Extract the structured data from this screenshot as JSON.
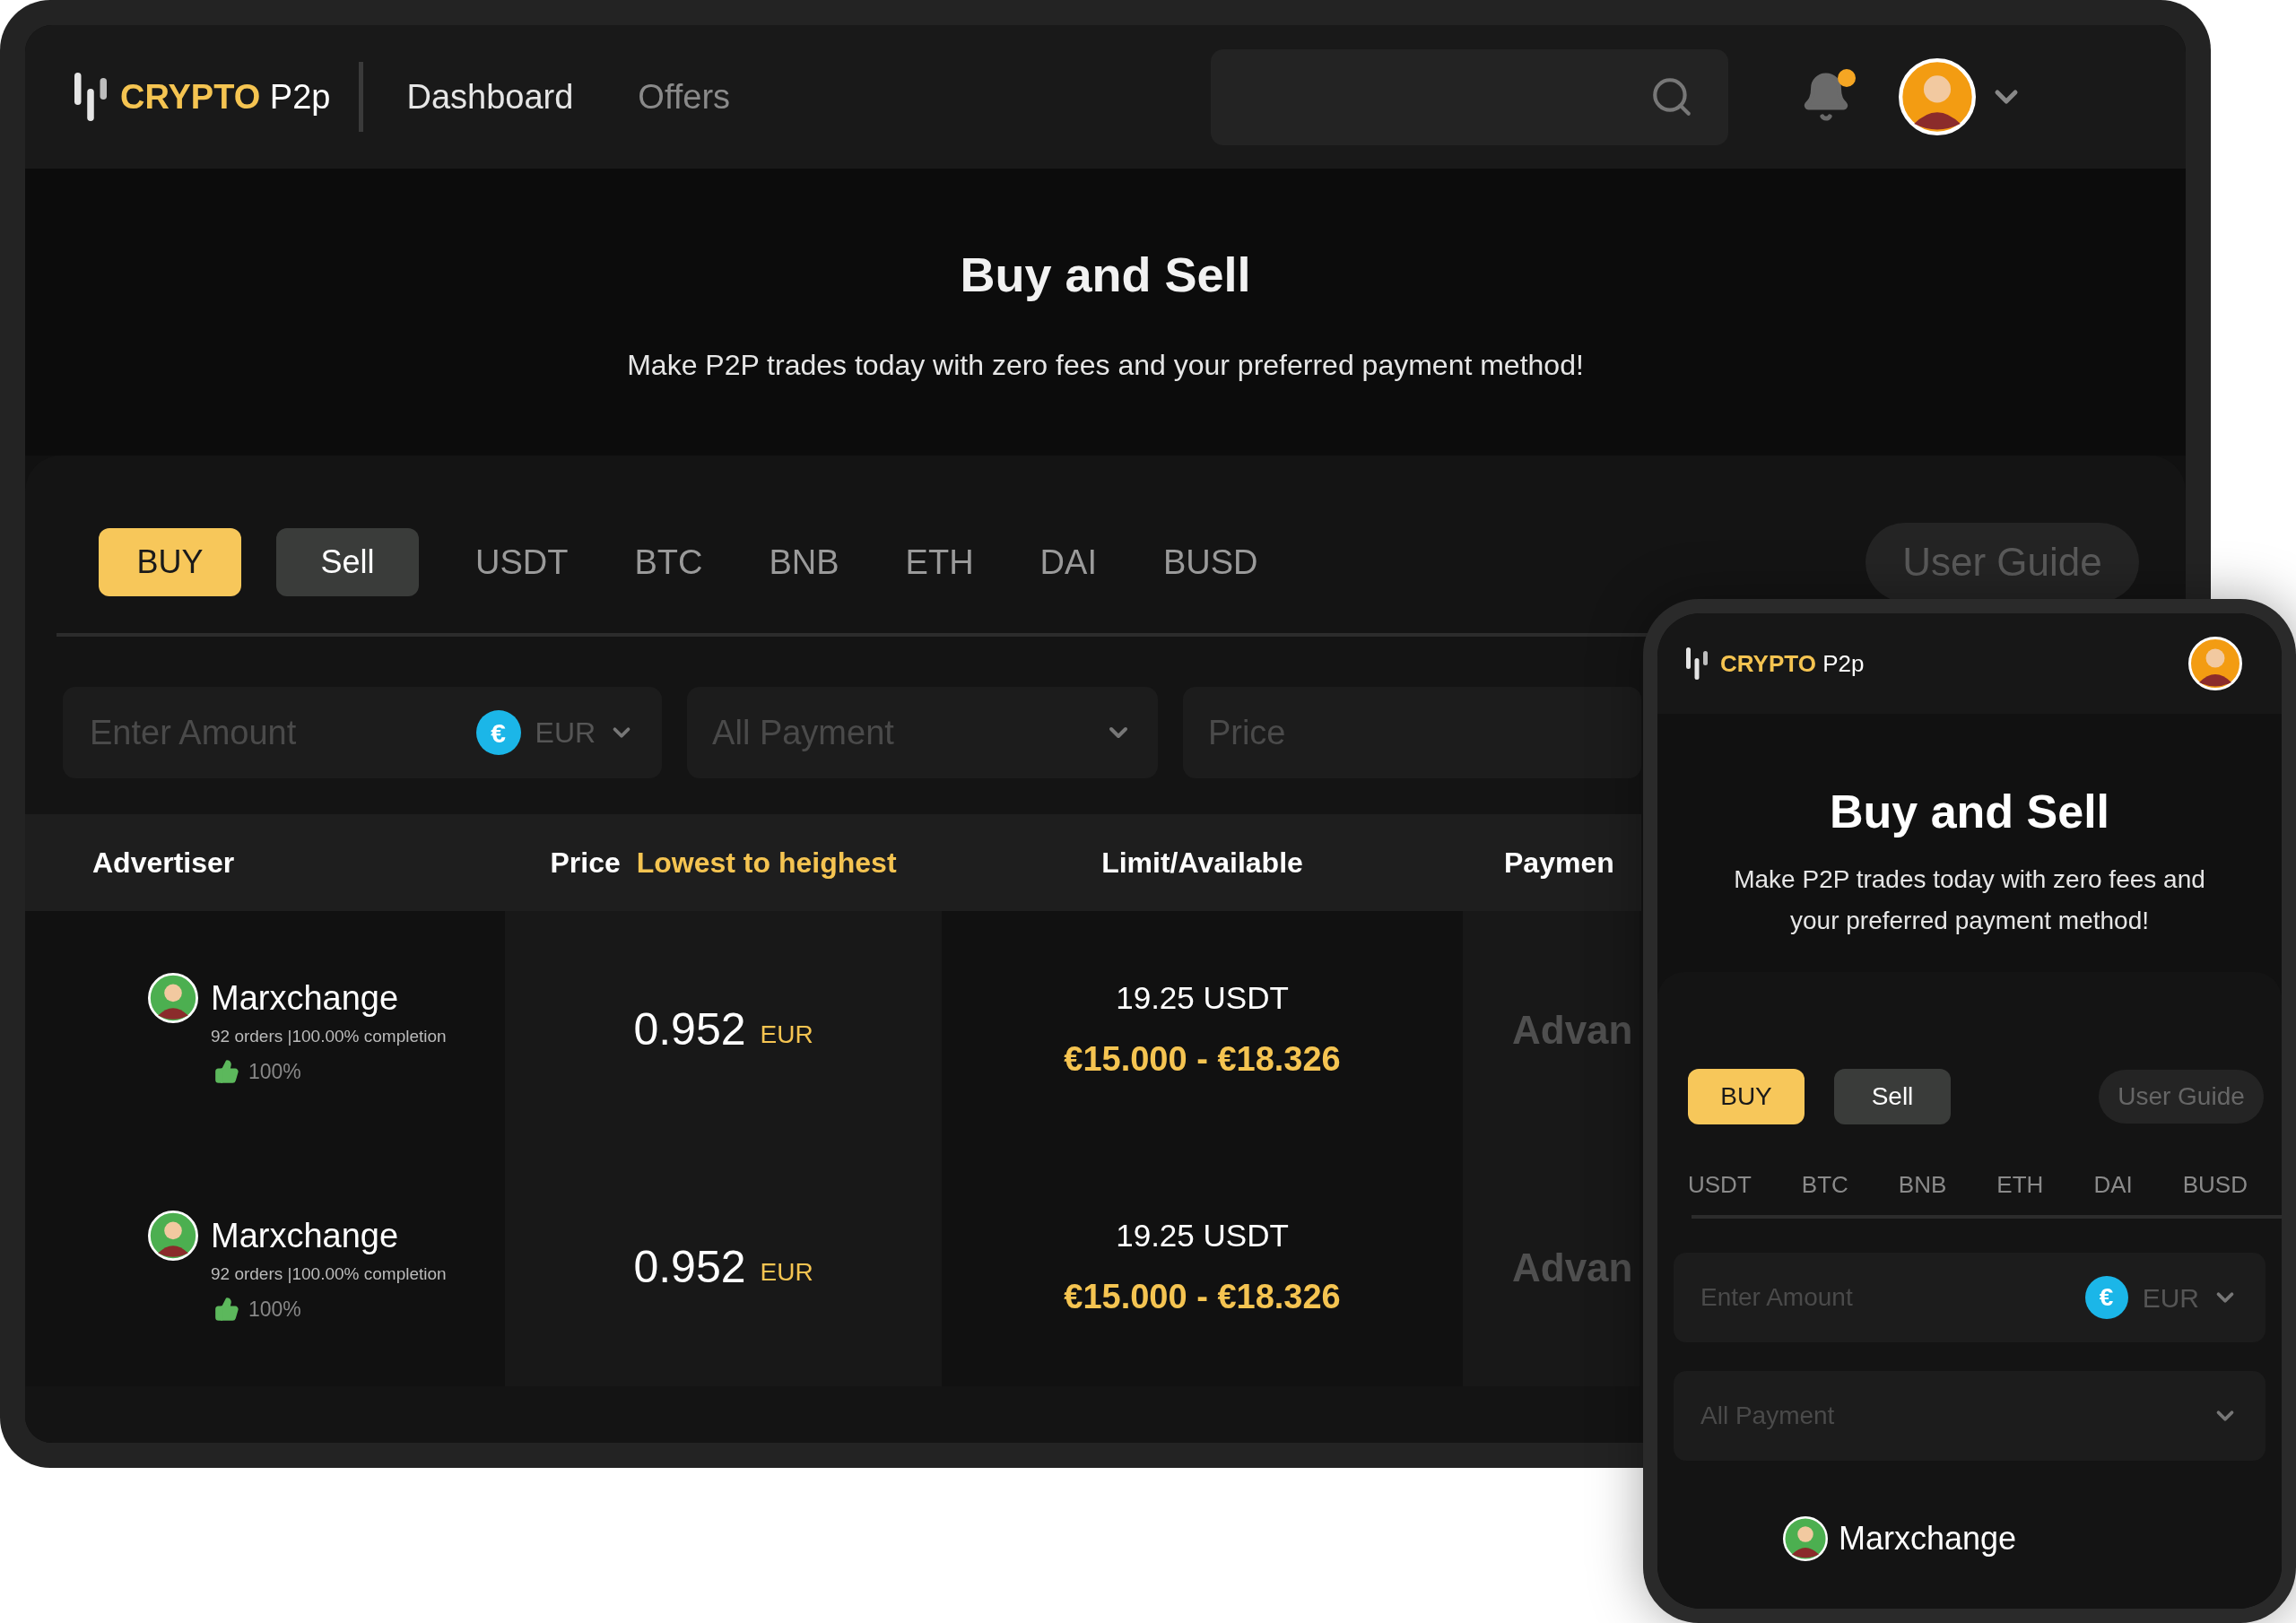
{
  "desktop": {
    "logo": {
      "brand": "CRYPTO",
      "suffix": "P2p"
    },
    "nav": [
      {
        "label": "Dashboard",
        "selected": true
      },
      {
        "label": "Offers",
        "selected": false
      }
    ],
    "notifications": {
      "unread": true
    },
    "hero": {
      "title": "Buy and Sell",
      "subtitle": "Make P2P trades today with zero fees and your preferred payment method!"
    },
    "trade_tabs": [
      {
        "label": "BUY",
        "selected": true
      },
      {
        "label": "Sell",
        "selected": false
      }
    ],
    "coins": [
      "USDT",
      "BTC",
      "BNB",
      "ETH",
      "DAI",
      "BUSD"
    ],
    "user_guide": "User Guide",
    "filters": {
      "amount": {
        "placeholder": "Enter Amount",
        "currency_symbol": "€",
        "currency": "EUR"
      },
      "payment": {
        "placeholder": "All Payment"
      },
      "price": {
        "placeholder": "Price"
      }
    },
    "table": {
      "columns": [
        {
          "label": "Advertiser"
        },
        {
          "label": "Price",
          "sort": "Lowest to heighest"
        },
        {
          "label": "Limit/Available"
        },
        {
          "label": "Paymen"
        }
      ],
      "rows": [
        {
          "name": "Marxchange",
          "orders": "92 orders |100.00% completion",
          "rating": "100%",
          "price": "0.952",
          "currency": "EUR",
          "available": "19.25 USDT",
          "limit": "€15.000 - €18.326",
          "payment": "Advan"
        },
        {
          "name": "Marxchange",
          "orders": "92 orders |100.00% completion",
          "rating": "100%",
          "price": "0.952",
          "currency": "EUR",
          "available": "19.25 USDT",
          "limit": "€15.000 - €18.326",
          "payment": "Advan"
        }
      ]
    }
  },
  "mobile": {
    "logo": {
      "brand": "CRYPTO",
      "suffix": "P2p"
    },
    "hero": {
      "title": "Buy and Sell",
      "subtitle": "Make P2P trades today with zero fees and your preferred payment method!"
    },
    "trade_tabs": [
      {
        "label": "BUY",
        "selected": true
      },
      {
        "label": "Sell",
        "selected": false
      }
    ],
    "user_guide": "User Guide",
    "coins": [
      "USDT",
      "BTC",
      "BNB",
      "ETH",
      "DAI",
      "BUSD"
    ],
    "filters": {
      "amount": {
        "placeholder": "Enter Amount",
        "currency_symbol": "€",
        "currency": "EUR"
      },
      "payment": {
        "placeholder": "All Payment"
      }
    },
    "rows": [
      {
        "name": "Marxchange"
      }
    ]
  }
}
